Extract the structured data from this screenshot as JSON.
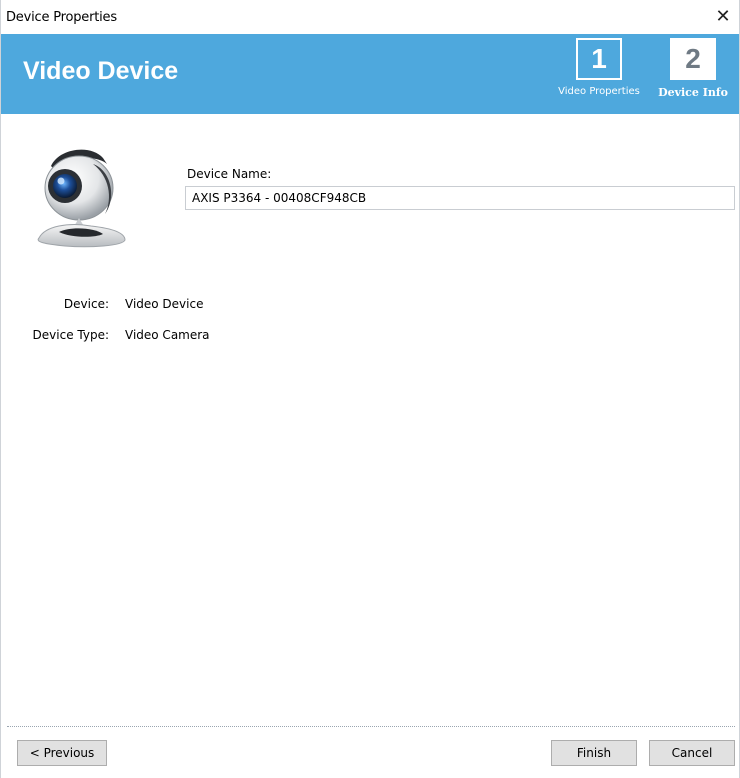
{
  "window": {
    "title": "Device Properties",
    "close_glyph": "✕"
  },
  "banner": {
    "heading": "Video Device",
    "bg_color": "#4ea8dd",
    "steps": [
      {
        "number": "1",
        "label": "Video Properties",
        "active": false
      },
      {
        "number": "2",
        "label": "Device Info",
        "active": true
      }
    ]
  },
  "form": {
    "device_name_label": "Device Name:",
    "device_name_value": "AXIS P3364 - 00408CF948CB",
    "camera_icon": "webcam-icon"
  },
  "properties": [
    {
      "key": "Device:",
      "value": "Video Device"
    },
    {
      "key": "Device Type:",
      "value": "Video Camera"
    }
  ],
  "buttons": {
    "previous": "< Previous",
    "finish": "Finish",
    "cancel": "Cancel"
  }
}
